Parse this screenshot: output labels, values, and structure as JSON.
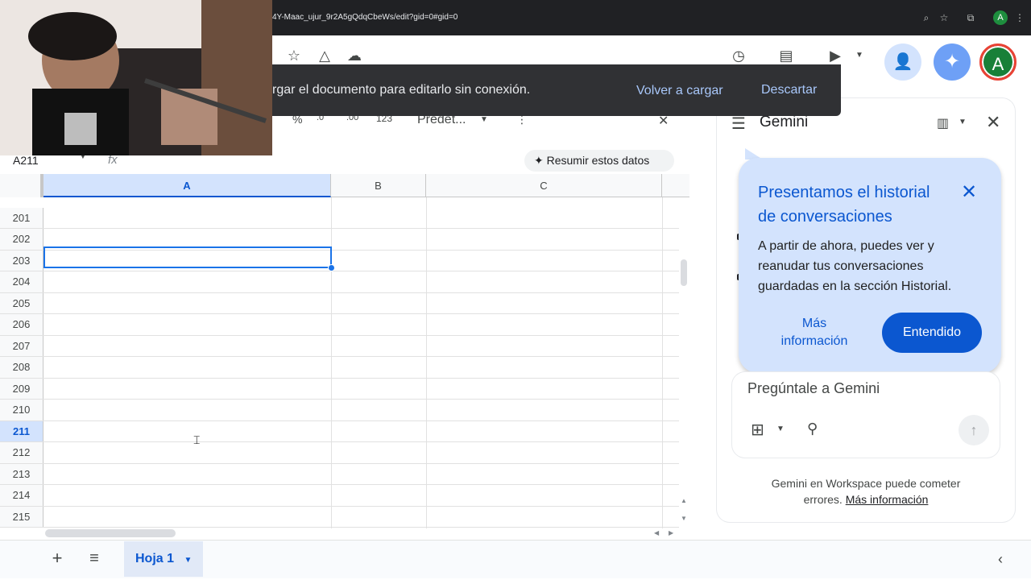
{
  "browser": {
    "url_fragment": "4Y-Maac_ujur_9r2A5gQdqCbeWs/edit?gid=0#gid=0",
    "avatar_letter": "A"
  },
  "toolbar": {
    "profile_letter": "A"
  },
  "snackbar": {
    "message": "rgar el documento para editarlo sin conexión.",
    "reload_label": "Volver a cargar",
    "dismiss_label": "Descartar"
  },
  "format_row": {
    "percent": "%",
    "decimals_down": ".0",
    "decimals_up": ".00",
    "format_123": "123",
    "font": "Predet..."
  },
  "formula_bar": {
    "name_box": "A211",
    "fx": "fx",
    "summarize_label": "Resumir estos datos"
  },
  "grid": {
    "columns": [
      "A",
      "B",
      "C"
    ],
    "rows": [
      "201",
      "202",
      "203",
      "204",
      "205",
      "206",
      "207",
      "208",
      "209",
      "210",
      "211",
      "212",
      "213",
      "214",
      "215"
    ],
    "selected_row": "211"
  },
  "sheets": {
    "active_tab": "Hoja 1"
  },
  "gemini": {
    "title": "Gemini",
    "callout": {
      "title": "Presentamos el historial de conversaciones",
      "body": "A partir de ahora, puedes ver y reanudar tus conversaciones guardadas en la sección Historial.",
      "more_label": "Más información",
      "ok_label": "Entendido"
    },
    "prompt_placeholder": "Pregúntale a Gemini",
    "disclaimer_text": "Gemini en Workspace puede cometer errores.",
    "disclaimer_link": "Más información"
  },
  "colors": {
    "accent": "#0b57d0",
    "selection": "#1a73e8",
    "callout_bg": "#d3e3fd",
    "snackbar_bg": "#303134"
  }
}
